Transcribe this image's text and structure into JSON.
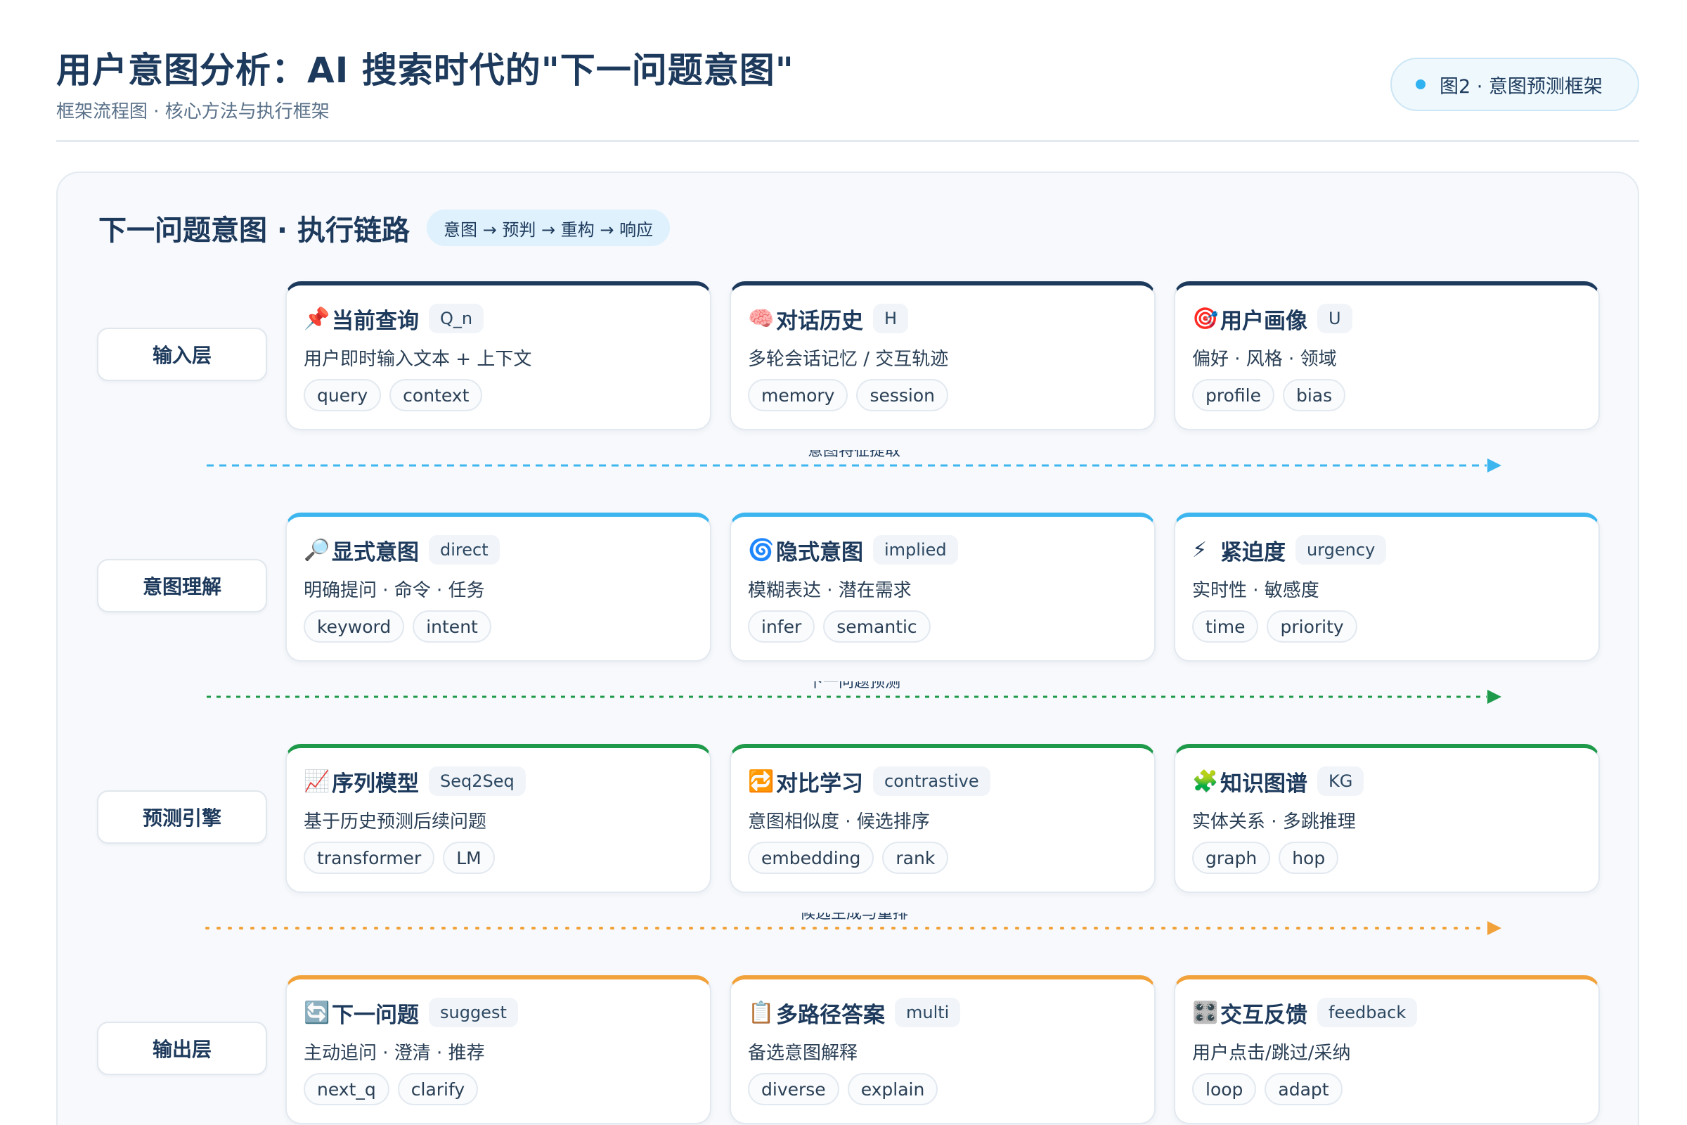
{
  "header": {
    "title": "用户意图分析：AI 搜索时代的\"下一问题意图\"",
    "subtitle": "框架流程图 · 核心方法与执行框架",
    "figure_badge": "图2 · 意图预测框架"
  },
  "panel": {
    "title": "下一问题意图 · 执行链路",
    "chain": "意图 → 预判 → 重构 → 响应"
  },
  "layers": [
    {
      "label": "输入层",
      "accent": "#1d3a5c",
      "cards": [
        {
          "icon": "📌",
          "icon_name": "pushpin-icon",
          "name": "当前查询",
          "symbol": "Q_n",
          "desc": "用户即时输入文本 + 上下文",
          "tags": [
            "query",
            "context"
          ]
        },
        {
          "icon": "🧠",
          "icon_name": "brain-icon",
          "name": "对话历史",
          "symbol": "H",
          "desc": "多轮会话记忆 / 交互轨迹",
          "tags": [
            "memory",
            "session"
          ]
        },
        {
          "icon": "🎯",
          "icon_name": "target-icon",
          "name": "用户画像",
          "symbol": "U",
          "desc": "偏好 · 风格 · 领域",
          "tags": [
            "profile",
            "bias"
          ]
        }
      ]
    },
    {
      "label": "意图理解",
      "accent": "#3db6ef",
      "cards": [
        {
          "icon": "🔎",
          "icon_name": "magnifier-icon",
          "name": "显式意图",
          "symbol": "direct",
          "desc": "明确提问 · 命令 · 任务",
          "tags": [
            "keyword",
            "intent"
          ]
        },
        {
          "icon": "🌀",
          "icon_name": "cyclone-icon",
          "name": "隐式意图",
          "symbol": "implied",
          "desc": "模糊表达 · 潜在需求",
          "tags": [
            "infer",
            "semantic"
          ]
        },
        {
          "icon": "⚡",
          "icon_name": "lightning-icon",
          "name": "紧迫度",
          "symbol": "urgency",
          "desc": "实时性 · 敏感度",
          "tags": [
            "time",
            "priority"
          ]
        }
      ]
    },
    {
      "label": "预测引擎",
      "accent": "#1e9a4a",
      "cards": [
        {
          "icon": "📈",
          "icon_name": "chart-increasing-icon",
          "name": "序列模型",
          "symbol": "Seq2Seq",
          "desc": "基于历史预测后续问题",
          "tags": [
            "transformer",
            "LM"
          ]
        },
        {
          "icon": "🔁",
          "icon_name": "repeat-icon",
          "name": "对比学习",
          "symbol": "contrastive",
          "desc": "意图相似度 · 候选排序",
          "tags": [
            "embedding",
            "rank"
          ]
        },
        {
          "icon": "🧩",
          "icon_name": "puzzle-icon",
          "name": "知识图谱",
          "symbol": "KG",
          "desc": "实体关系 · 多跳推理",
          "tags": [
            "graph",
            "hop"
          ]
        }
      ]
    },
    {
      "label": "输出层",
      "accent": "#f2a23a",
      "cards": [
        {
          "icon": "🔄",
          "icon_name": "refresh-icon",
          "name": "下一问题",
          "symbol": "suggest",
          "desc": "主动追问 · 澄清 · 推荐",
          "tags": [
            "next_q",
            "clarify"
          ]
        },
        {
          "icon": "📋",
          "icon_name": "clipboard-icon",
          "name": "多路径答案",
          "symbol": "multi",
          "desc": "备选意图解释",
          "tags": [
            "diverse",
            "explain"
          ]
        },
        {
          "icon": "🎛️",
          "icon_name": "control-knobs-icon",
          "name": "交互反馈",
          "symbol": "feedback",
          "desc": "用户点击/跳过/采纳",
          "tags": [
            "loop",
            "adapt"
          ]
        }
      ]
    }
  ],
  "flows": [
    {
      "label": "意图特征提取",
      "color": "#3db6ef",
      "style": "dashed"
    },
    {
      "label": "下一问题预测",
      "color": "#1e9a4a",
      "style": "dotted-dash"
    },
    {
      "label": "候选生成与重排",
      "color": "#f2a23a",
      "style": "dotted"
    }
  ]
}
